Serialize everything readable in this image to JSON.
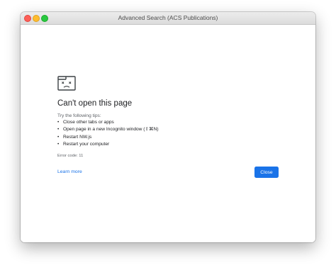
{
  "window": {
    "title": "Advanced Search (ACS Publications)"
  },
  "error_page": {
    "icon": "sad-tab-icon",
    "heading": "Can't open this page",
    "tips_intro": "Try the following tips:",
    "tips": [
      "Close other tabs or apps",
      "Open page in a new Incognito window (⇧⌘N)",
      "Restart NW.js",
      "Restart your computer"
    ],
    "error_code": "Error code: 11",
    "learn_more": "Learn more",
    "close_label": "Close"
  },
  "colors": {
    "accent": "#1a73e8",
    "heading": "#202124",
    "secondary": "#5f6368"
  }
}
